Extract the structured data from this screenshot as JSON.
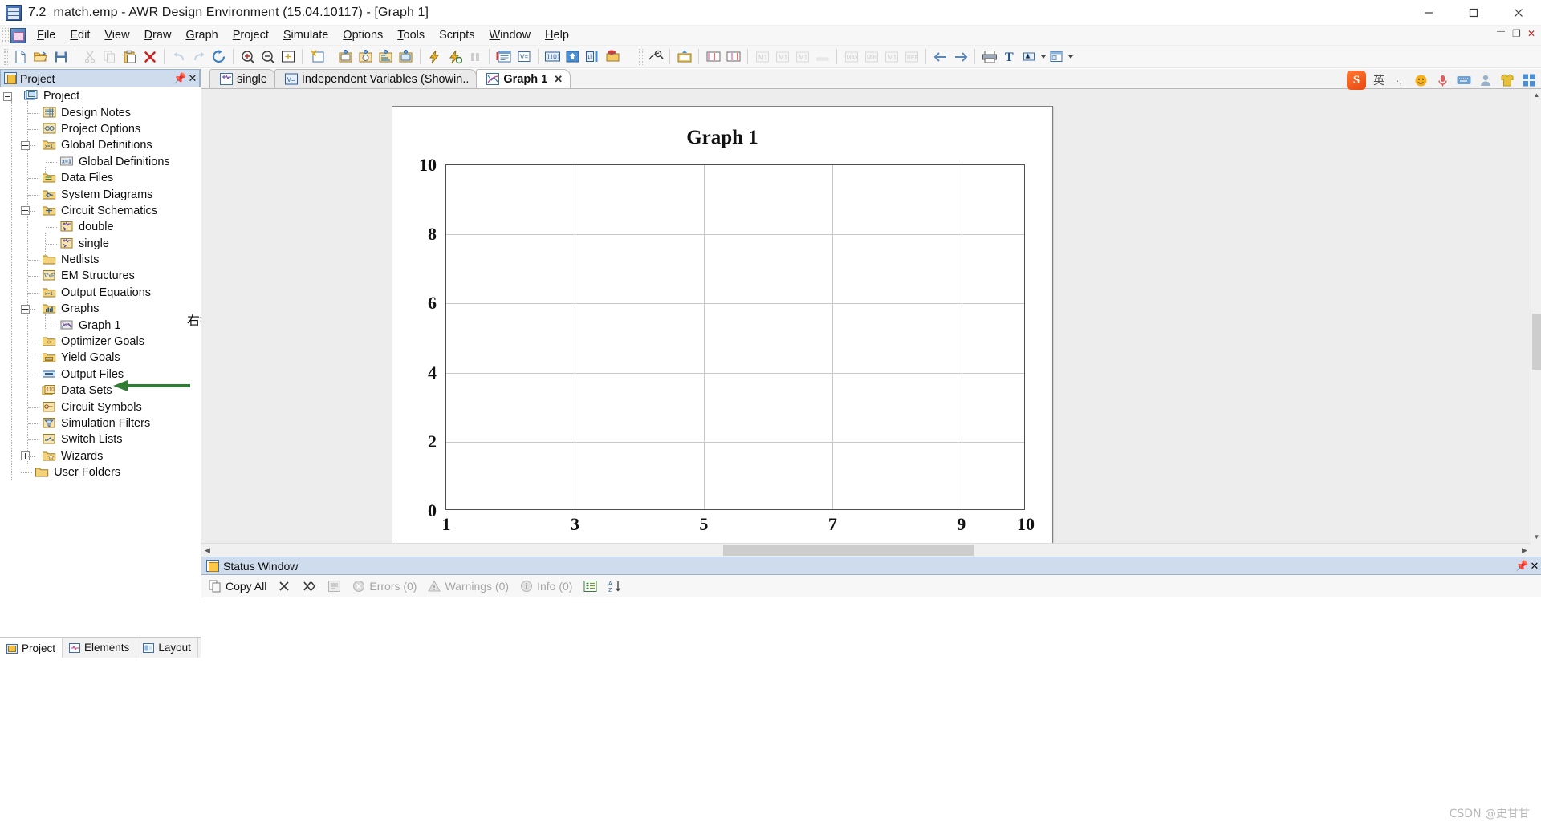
{
  "window": {
    "title": "7.2_match.emp - AWR Design Environment (15.04.10117) - [Graph 1]",
    "app_icon": "awr-logo-icon",
    "minimize": "minimize-icon",
    "maximize": "maximize-icon",
    "close": "close-icon"
  },
  "menubar": {
    "items": [
      {
        "label": "File",
        "mnemonic": "F"
      },
      {
        "label": "Edit",
        "mnemonic": "E"
      },
      {
        "label": "View",
        "mnemonic": "V"
      },
      {
        "label": "Draw",
        "mnemonic": "D"
      },
      {
        "label": "Graph",
        "mnemonic": "G"
      },
      {
        "label": "Project",
        "mnemonic": "P"
      },
      {
        "label": "Simulate",
        "mnemonic": "S"
      },
      {
        "label": "Options",
        "mnemonic": "O"
      },
      {
        "label": "Tools",
        "mnemonic": "T"
      },
      {
        "label": "Scripts",
        "mnemonic": ""
      },
      {
        "label": "Window",
        "mnemonic": "W"
      },
      {
        "label": "Help",
        "mnemonic": "H"
      }
    ],
    "mdi_minimize": "mdi-minimize-icon",
    "mdi_restore": "mdi-restore-icon",
    "mdi_close": "mdi-close-icon"
  },
  "toolbar": {
    "groups": [
      {
        "name": "standard",
        "buttons": [
          {
            "name": "new-project-icon",
            "tip": "New Project"
          },
          {
            "name": "open-project-icon",
            "tip": "Open Project"
          },
          {
            "name": "save-project-icon",
            "tip": "Save Project"
          },
          {
            "name": "cut-icon",
            "tip": "Cut",
            "disabled": true
          },
          {
            "name": "copy-icon",
            "tip": "Copy",
            "disabled": true
          },
          {
            "name": "paste-icon",
            "tip": "Paste"
          },
          {
            "name": "delete-icon",
            "tip": "Delete"
          },
          {
            "name": "undo-icon",
            "tip": "Undo",
            "disabled": true
          },
          {
            "name": "redo-icon",
            "tip": "Redo",
            "disabled": true
          },
          {
            "name": "refresh-icon",
            "tip": "Refresh"
          }
        ]
      },
      {
        "name": "view",
        "buttons": [
          {
            "name": "zoom-in-icon",
            "tip": "Zoom In"
          },
          {
            "name": "zoom-out-icon",
            "tip": "Zoom Out"
          },
          {
            "name": "view-all-icon",
            "tip": "View All"
          },
          {
            "name": "new-graph-icon",
            "tip": "Add Graph"
          },
          {
            "name": "add-rect-measurement-icon",
            "tip": "Add Rectangular Measurement"
          },
          {
            "name": "add-smith-measurement-icon",
            "tip": "Add Smith Chart Measurement"
          },
          {
            "name": "add-polar-measurement-icon",
            "tip": "Add Polar Measurement"
          },
          {
            "name": "add-tabular-measurement-icon",
            "tip": "Add Tabular Measurement"
          },
          {
            "name": "analyze-icon",
            "tip": "Analyze"
          },
          {
            "name": "tune-icon",
            "tip": "Tune"
          },
          {
            "name": "stop-icon",
            "tip": "Stop",
            "disabled": true
          },
          {
            "name": "output-window-icon",
            "tip": "Output Window"
          },
          {
            "name": "variable-browser-icon",
            "tip": "Variable Browser"
          },
          {
            "name": "tune-tool-icon",
            "tip": "Tune Tool"
          },
          {
            "name": "optimize-icon",
            "tip": "Optimize"
          },
          {
            "name": "yield-analysis-icon",
            "tip": "Yield Analysis"
          },
          {
            "name": "tune-variables-icon",
            "tip": "Tune Variables"
          }
        ]
      },
      {
        "name": "graph",
        "buttons": [
          {
            "name": "graph-properties-icon",
            "tip": "Graph Properties"
          },
          {
            "name": "marker-add-icon",
            "tip": "Add Marker"
          },
          {
            "name": "marker-left-icon",
            "tip": "Marker Left"
          },
          {
            "name": "marker-right-icon",
            "tip": "Marker Right"
          },
          {
            "name": "marker-max-icon",
            "tip": "MAX"
          },
          {
            "name": "marker-min-icon",
            "tip": "MIN"
          },
          {
            "name": "marker-delta-icon",
            "tip": "M1"
          },
          {
            "name": "marker-ref-icon",
            "tip": "REF"
          },
          {
            "name": "back-icon",
            "tip": "Back"
          },
          {
            "name": "forward-icon",
            "tip": "Forward"
          },
          {
            "name": "print-icon",
            "tip": "Print"
          },
          {
            "name": "text-icon",
            "tip": "Add Text"
          },
          {
            "name": "text-style-icon",
            "tip": "Text Style"
          },
          {
            "name": "layout-icon",
            "tip": "Layout"
          }
        ]
      }
    ]
  },
  "project_panel": {
    "caption": "Project",
    "caption_icon": "project-window-icon",
    "pin_button": "pin-icon",
    "close_button": "close-icon",
    "tree": [
      {
        "label": "Project",
        "icon": "project-root-icon",
        "depth": 0,
        "expander": "minus"
      },
      {
        "label": "Design Notes",
        "icon": "design-notes-icon",
        "depth": 1,
        "expander": ""
      },
      {
        "label": "Project Options",
        "icon": "project-options-icon",
        "depth": 1,
        "expander": ""
      },
      {
        "label": "Global Definitions",
        "icon": "global-definitions-folder-icon",
        "depth": 1,
        "expander": "minus"
      },
      {
        "label": "Global Definitions",
        "icon": "equation-icon",
        "depth": 2,
        "expander": ""
      },
      {
        "label": "Data Files",
        "icon": "data-files-icon",
        "depth": 1,
        "expander": ""
      },
      {
        "label": "System Diagrams",
        "icon": "system-diagrams-icon",
        "depth": 1,
        "expander": ""
      },
      {
        "label": "Circuit Schematics",
        "icon": "circuit-schematics-icon",
        "depth": 1,
        "expander": "minus"
      },
      {
        "label": "double",
        "icon": "schematic-icon",
        "depth": 2,
        "expander": ""
      },
      {
        "label": "single",
        "icon": "schematic-icon",
        "depth": 2,
        "expander": ""
      },
      {
        "label": "Netlists",
        "icon": "netlists-folder-icon",
        "depth": 1,
        "expander": ""
      },
      {
        "label": "EM Structures",
        "icon": "em-structures-icon",
        "depth": 1,
        "expander": ""
      },
      {
        "label": "Output Equations",
        "icon": "output-equations-icon",
        "depth": 1,
        "expander": ""
      },
      {
        "label": "Graphs",
        "icon": "graphs-folder-icon",
        "depth": 1,
        "expander": "minus"
      },
      {
        "label": "Graph 1",
        "icon": "graph-item-icon",
        "depth": 2,
        "expander": ""
      },
      {
        "label": "Optimizer Goals",
        "icon": "optimizer-goals-icon",
        "depth": 1,
        "expander": ""
      },
      {
        "label": "Yield Goals",
        "icon": "yield-goals-icon",
        "depth": 1,
        "expander": ""
      },
      {
        "label": "Output Files",
        "icon": "output-files-icon",
        "depth": 1,
        "expander": ""
      },
      {
        "label": "Data Sets",
        "icon": "data-sets-icon",
        "depth": 1,
        "expander": ""
      },
      {
        "label": "Circuit Symbols",
        "icon": "circuit-symbols-icon",
        "depth": 1,
        "expander": ""
      },
      {
        "label": "Simulation Filters",
        "icon": "simulation-filters-icon",
        "depth": 1,
        "expander": ""
      },
      {
        "label": "Switch Lists",
        "icon": "switch-lists-icon",
        "depth": 1,
        "expander": ""
      },
      {
        "label": "Wizards",
        "icon": "wizards-icon",
        "depth": 1,
        "expander": "plus"
      },
      {
        "label": "User Folders",
        "icon": "user-folders-icon",
        "depth": 0.6,
        "expander": ""
      }
    ],
    "bottom_tabs": [
      {
        "label": "Project",
        "icon": "project-tab-icon",
        "active": true
      },
      {
        "label": "Elements",
        "icon": "elements-tab-icon",
        "active": false
      },
      {
        "label": "Layout",
        "icon": "layout-tab-icon",
        "active": false
      }
    ]
  },
  "annotation": {
    "text": "右键这里",
    "arrow_color": "#2e7d32"
  },
  "document_tabs": [
    {
      "label": "single",
      "icon": "schematic-tab-icon",
      "active": false,
      "closable": false
    },
    {
      "label": "Independent Variables (Showin..",
      "icon": "variables-tab-icon",
      "active": false,
      "closable": false
    },
    {
      "label": "Graph 1",
      "icon": "graph-tab-icon",
      "active": true,
      "closable": true,
      "close_glyph": "✕"
    }
  ],
  "chart_data": {
    "type": "line",
    "title": "Graph 1",
    "xlabel": "",
    "ylabel": "",
    "xlim": [
      1,
      10
    ],
    "ylim": [
      0,
      10
    ],
    "xticks": [
      1,
      3,
      5,
      7,
      9,
      10
    ],
    "yticks": [
      0,
      2,
      4,
      6,
      8,
      10
    ],
    "x_gridlines": [
      3,
      5,
      7,
      9
    ],
    "y_gridlines": [
      2,
      4,
      6,
      8
    ],
    "grid": true,
    "legend": "none",
    "series": [],
    "note": "Empty graph - no traces plotted"
  },
  "status_window": {
    "caption": "Status Window",
    "caption_icon": "status-window-icon",
    "pin_button": "pin-icon",
    "close_button": "close-icon",
    "toolbar": [
      {
        "label": "Copy All",
        "icon": "copy-all-icon",
        "disabled": false
      },
      {
        "label": "",
        "icon": "clear-icon",
        "disabled": false
      },
      {
        "label": "",
        "icon": "clear-all-icon",
        "disabled": false
      },
      {
        "label": "",
        "icon": "export-icon",
        "disabled": true
      },
      {
        "label": "Errors (0)",
        "icon": "error-icon",
        "disabled": true
      },
      {
        "label": "Warnings (0)",
        "icon": "warning-icon",
        "disabled": true
      },
      {
        "label": "Info (0)",
        "icon": "info-icon",
        "disabled": true
      },
      {
        "label": "",
        "icon": "group-icon",
        "disabled": false
      },
      {
        "label": "",
        "icon": "sort-az-icon",
        "disabled": false
      }
    ],
    "messages": []
  },
  "ime_tray": {
    "logo": "S",
    "items": [
      {
        "name": "ime-language-label",
        "glyph": "英"
      },
      {
        "name": "ime-punctuation-icon",
        "glyph": "·,"
      },
      {
        "name": "ime-emoji-icon",
        "glyph": "☺"
      },
      {
        "name": "ime-voice-icon",
        "glyph": "🎤"
      },
      {
        "name": "ime-keyboard-icon",
        "glyph": "⌨"
      },
      {
        "name": "ime-user-icon",
        "glyph": "👤"
      },
      {
        "name": "ime-skin-icon",
        "glyph": "👕"
      },
      {
        "name": "ime-toolbox-icon",
        "glyph": "⊞"
      }
    ]
  },
  "watermark": {
    "text": "CSDN @史甘甘"
  },
  "colors": {
    "caption_bg": "#cfdced",
    "toolbar_bg": "#f7f7f7",
    "canvas_bg": "#ededed",
    "grid": "#c9c9c9",
    "plot_border": "#4f4f4f",
    "annotation_green": "#2e7d32"
  }
}
